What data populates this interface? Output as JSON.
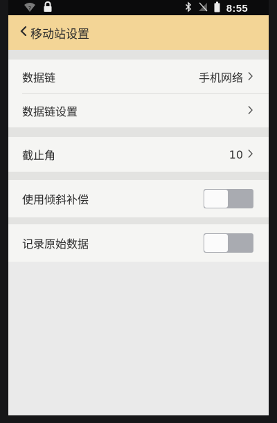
{
  "status_bar": {
    "time": "8:55",
    "icons": [
      "wifi-question-icon",
      "lock-icon",
      "bluetooth-icon",
      "no-signal-icon",
      "battery-icon"
    ]
  },
  "toolbar": {
    "back_icon": "chevron-left-icon",
    "title": "移动站设置",
    "background_color": "#f3d596"
  },
  "settings": {
    "data_link": {
      "label": "数据链",
      "value": "手机网络"
    },
    "data_link_settings": {
      "label": "数据链设置"
    },
    "cutoff_angle": {
      "label": "截止角",
      "value": "10"
    },
    "tilt_compensation": {
      "label": "使用倾斜补偿",
      "enabled": false
    },
    "record_raw_data": {
      "label": "记录原始数据",
      "enabled": false
    }
  }
}
